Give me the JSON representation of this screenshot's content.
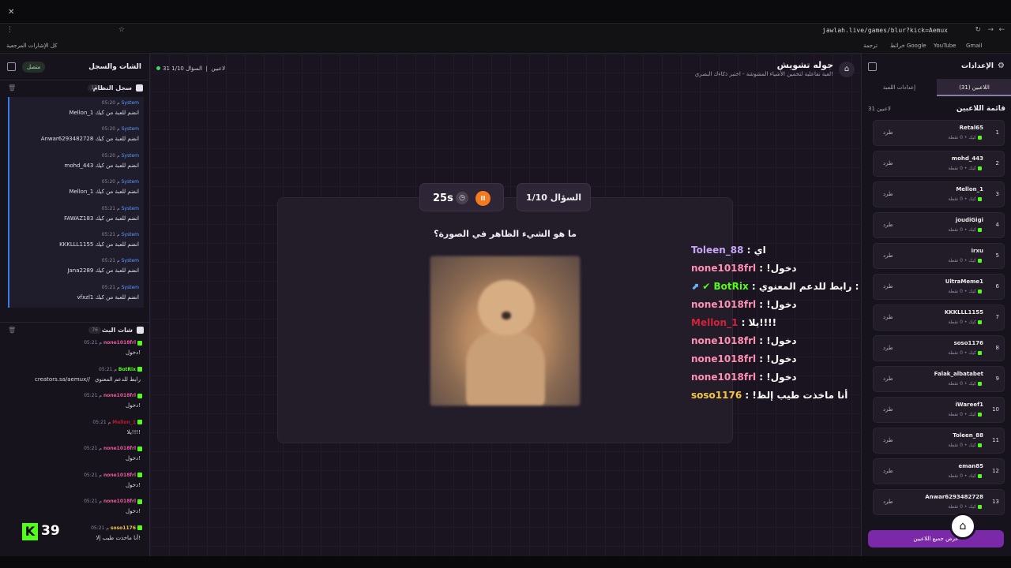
{
  "browser": {
    "url": "jawlah.live/games/blur?kick=Aemux",
    "bookmarks": [
      "كل الإشارات المرجعية",
      "Gmail",
      "YouTube",
      "خرائط Google",
      "ترجمة"
    ]
  },
  "left_panel": {
    "title": "الشات والسجل",
    "status": "متصل",
    "system_log": {
      "label": "سجل النظام",
      "count": "17",
      "items": [
        {
          "sender": "System",
          "time": "05:20 م",
          "text": "Mellon_1 انضم للعبة من كيك"
        },
        {
          "sender": "System",
          "time": "05:20 م",
          "text": "Anwar6293482728 انضم للعبة من كيك"
        },
        {
          "sender": "System",
          "time": "05:20 م",
          "text": "mohd_443 انضم للعبة من كيك"
        },
        {
          "sender": "System",
          "time": "05:20 م",
          "text": "Mellon_1 انضم للعبة من كيك"
        },
        {
          "sender": "System",
          "time": "05:21 م",
          "text": "FAWAZ183 انضم للعبة من كيك"
        },
        {
          "sender": "System",
          "time": "05:21 م",
          "text": "KKKLLL1155 انضم للعبة من كيك"
        },
        {
          "sender": "System",
          "time": "05:21 م",
          "text": "Jana2289 انضم للعبة من كيك"
        },
        {
          "sender": "System",
          "time": "05:21 م",
          "text": "vfxzl1 انضم للعبة من كيك"
        }
      ]
    },
    "live_chat": {
      "label": "شات البث",
      "count": "76",
      "items": [
        {
          "user": "none1018frl",
          "color": "#e85a9a",
          "time": "05:21 م",
          "text": "دخول!"
        },
        {
          "user": "BotRix",
          "color": "#53fc18",
          "time": "05:21 م",
          "text": "رابط للدعم المعنوي",
          "extra": "creators.sa/aemux//"
        },
        {
          "user": "none1018frl",
          "color": "#e85a9a",
          "time": "05:21 م",
          "text": "دخول!"
        },
        {
          "user": "Mellon_1",
          "color": "#c0192e",
          "time": "05:21 م",
          "text": "يلا!!!!"
        },
        {
          "user": "none1018frl",
          "color": "#e85a9a",
          "time": "05:21 م",
          "text": "دخول!"
        },
        {
          "user": "none1018frl",
          "color": "#e85a9a",
          "time": "05:21 م",
          "text": "دخول!"
        },
        {
          "user": "none1018frl",
          "color": "#e85a9a",
          "time": "05:21 م",
          "text": "دخول!"
        },
        {
          "user": "soso1176",
          "color": "#f0c24a",
          "time": "05:21 م",
          "text": "أنا ماخذت طيب إلا!"
        }
      ]
    },
    "viewer_count": "39"
  },
  "middle": {
    "game_title": "جوله تشويش",
    "game_subtitle": "لعبة تفاعلية لتخمين الأشياء المشوشة - اختبر ذكاءك البصري!",
    "players_meta": "31 لاعبين",
    "question_meta": "السؤال 1/10",
    "question_badge": "السؤال 1/10",
    "timer": "25s",
    "question": "ما هو الشيء الظاهر في الصورة؟",
    "overlay_chat": [
      {
        "user": "Toleen_88",
        "color": "#c7a6f5",
        "text": "اي"
      },
      {
        "user": "none1018frl",
        "color": "#ff8fb3",
        "text": "!دخول"
      },
      {
        "user": "BotRix",
        "color": "#53fc18",
        "text": "رابط للدعم المعنوي : https://creators.sa/aemux",
        "badge": true
      },
      {
        "user": "none1018frl",
        "color": "#ff8fb3",
        "text": "!دخول"
      },
      {
        "user": "Mellon_1",
        "color": "#d4223a",
        "text": "يلا!!!!"
      },
      {
        "user": "none1018frl",
        "color": "#ff8fb3",
        "text": "!دخول"
      },
      {
        "user": "none1018frl",
        "color": "#ff8fb3",
        "text": "!دخول"
      },
      {
        "user": "none1018frl",
        "color": "#ff8fb3",
        "text": "!دخول"
      },
      {
        "user": "soso1176",
        "color": "#f5c646",
        "text": "!أنا ماخذت طيب إلظ"
      }
    ]
  },
  "right_panel": {
    "title": "الإعدادات",
    "tab_players": "اللاعبين (31)",
    "tab_settings": "إعدادات اللعبة",
    "list_title": "قائمة اللاعبين",
    "list_count": "31 لاعبين",
    "kick_label": "طرد",
    "points_label": "كيك • 0 نقطة",
    "players": [
      {
        "rank": "1",
        "name": "Retal65"
      },
      {
        "rank": "2",
        "name": "mohd_443"
      },
      {
        "rank": "3",
        "name": "Mellon_1"
      },
      {
        "rank": "4",
        "name": "joudiGigi"
      },
      {
        "rank": "5",
        "name": "irxu"
      },
      {
        "rank": "6",
        "name": "UltraMeme1"
      },
      {
        "rank": "7",
        "name": "KKKLLL1155"
      },
      {
        "rank": "8",
        "name": "soso1176"
      },
      {
        "rank": "9",
        "name": "Falak_albatabet"
      },
      {
        "rank": "10",
        "name": "iWareef1"
      },
      {
        "rank": "11",
        "name": "Toleen_88"
      },
      {
        "rank": "12",
        "name": "eman85"
      },
      {
        "rank": "13",
        "name": "Anwar6293482728"
      }
    ],
    "show_all": "عرض جميع اللاعبين"
  }
}
